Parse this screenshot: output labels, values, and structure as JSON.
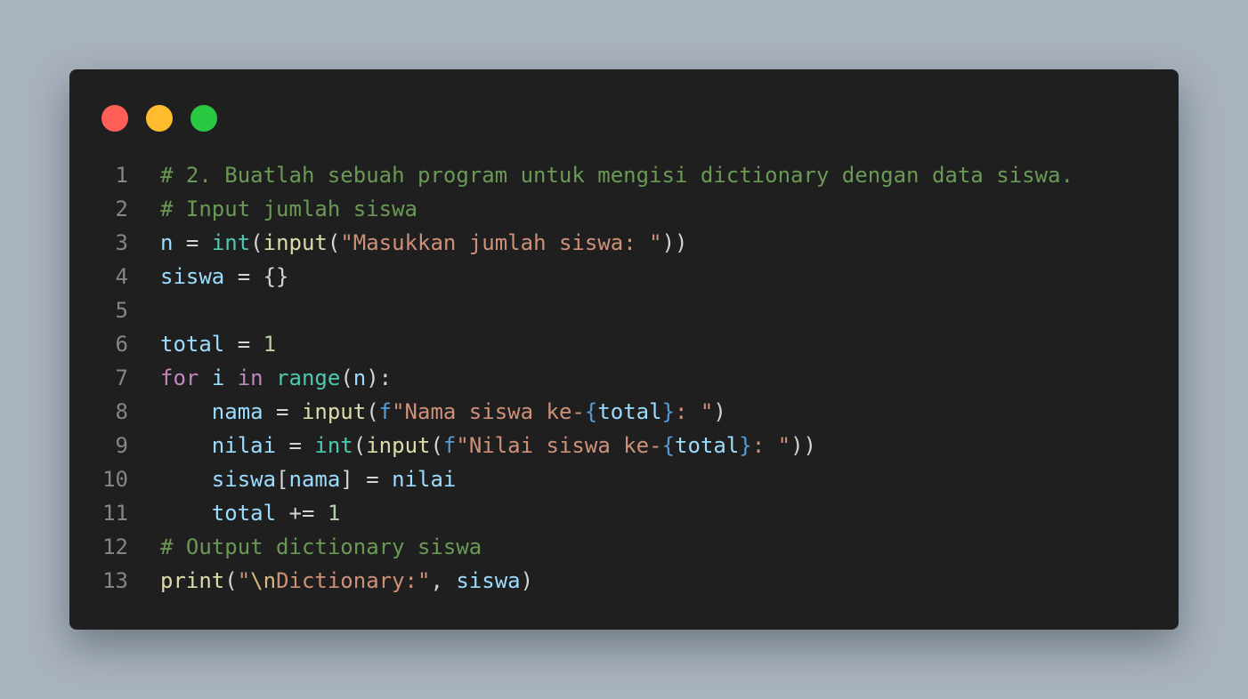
{
  "colors": {
    "background": "#a9b3be",
    "window": "#1f1f1f",
    "close": "#ff5f57",
    "minimize": "#febc2e",
    "maximize": "#28c840",
    "comment": "#6a9955",
    "variable": "#9cdcfe",
    "type": "#4ec9b0",
    "function": "#dcdcaa",
    "string": "#ce9178",
    "number": "#b5cea8",
    "keyword": "#c586c0",
    "line_number": "#858585"
  },
  "window_controls": [
    "close-icon",
    "minimize-icon",
    "maximize-icon"
  ],
  "code": {
    "line_numbers": [
      "1",
      "2",
      "3",
      "4",
      "5",
      "6",
      "7",
      "8",
      "9",
      "10",
      "11",
      "12",
      "13"
    ],
    "l1": {
      "comment": "# 2. Buatlah sebuah program untuk mengisi dictionary dengan data siswa."
    },
    "l2": {
      "comment": "# Input jumlah siswa"
    },
    "l3": {
      "var": "n",
      "eq": " = ",
      "type": "int",
      "p1": "(",
      "fn": "input",
      "p2": "(",
      "str": "\"Masukkan jumlah siswa: \"",
      "p3": "))"
    },
    "l4": {
      "var": "siswa",
      "eq": " = ",
      "rest": "{}"
    },
    "l5": {
      "text": ""
    },
    "l6": {
      "var": "total",
      "eq": " = ",
      "num": "1"
    },
    "l7": {
      "kw1": "for",
      "sp1": " ",
      "var": "i",
      "sp2": " ",
      "kw2": "in",
      "sp3": " ",
      "fn": "range",
      "p1": "(",
      "arg": "n",
      "p2": "):"
    },
    "l8": {
      "indent": "    ",
      "var": "nama",
      "eq": " = ",
      "fn": "input",
      "p1": "(",
      "fpre": "f",
      "str1": "\"Nama siswa ke-",
      "b1": "{",
      "inner": "total",
      "b2": "}",
      "str2": ": \"",
      "p2": ")"
    },
    "l9": {
      "indent": "    ",
      "var": "nilai",
      "eq": " = ",
      "type": "int",
      "p1": "(",
      "fn": "input",
      "p2": "(",
      "fpre": "f",
      "str1": "\"Nilai siswa ke-",
      "b1": "{",
      "inner": "total",
      "b2": "}",
      "str2": ": \"",
      "p3": "))"
    },
    "l10": {
      "indent": "    ",
      "var1": "siswa",
      "br1": "[",
      "var2": "nama",
      "br2": "]",
      "eq": " = ",
      "var3": "nilai"
    },
    "l11": {
      "indent": "    ",
      "var": "total",
      "op": " += ",
      "num": "1"
    },
    "l12": {
      "comment": "# Output dictionary siswa"
    },
    "l13": {
      "fn": "print",
      "p1": "(",
      "str1": "\"",
      "esc": "\\n",
      "str2": "Dictionary:\"",
      "comma": ", ",
      "var": "siswa",
      "p2": ")"
    }
  }
}
